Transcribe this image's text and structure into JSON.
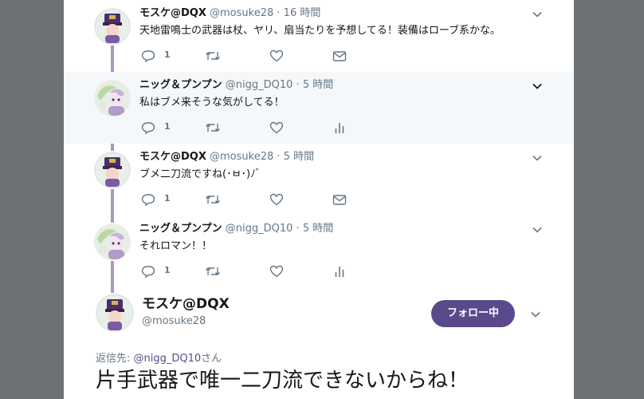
{
  "tweets": [
    {
      "name": "モスケ@DQX",
      "handle": "@mosuke28",
      "time": "16 時間",
      "text": "天地雷鳴士の武器は杖、ヤリ、扇当たりを予想してる！装備はローブ系かな。",
      "reply_count": "1",
      "highlighted": false,
      "last_action": "dm-icon"
    },
    {
      "name": "ニッグ＆プンプン",
      "handle": "@nigg_DQ10",
      "time": "5 時間",
      "text": "私はブメ来そうな気がしてる！",
      "reply_count": "1",
      "highlighted": true,
      "last_action": "analytics-icon"
    },
    {
      "name": "モスケ@DQX",
      "handle": "@mosuke28",
      "time": "5 時間",
      "text": "ブメ二刀流ですね(･ㅂ･)ﾉﾞ",
      "reply_count": "1",
      "highlighted": false,
      "last_action": "dm-icon"
    },
    {
      "name": "ニッグ＆プンプン",
      "handle": "@nigg_DQ10",
      "time": "5 時間",
      "text": "それロマン！！",
      "reply_count": "1",
      "highlighted": false,
      "last_action": "analytics-icon"
    }
  ],
  "main_tweet": {
    "name": "モスケ@DQX",
    "handle": "@mosuke28",
    "follow_label": "フォロー中",
    "reply_prefix": "返信先: ",
    "reply_mention": "@nigg_DQ10",
    "reply_suffix": "さん",
    "text": "片手武器で唯一二刀流できないからね！"
  },
  "colors": {
    "accent": "#5b4a8b",
    "thread_line": "#a79ac4",
    "muted_text": "#657786",
    "highlight_bg": "#f5f8fa",
    "backdrop": "#6f7275"
  }
}
